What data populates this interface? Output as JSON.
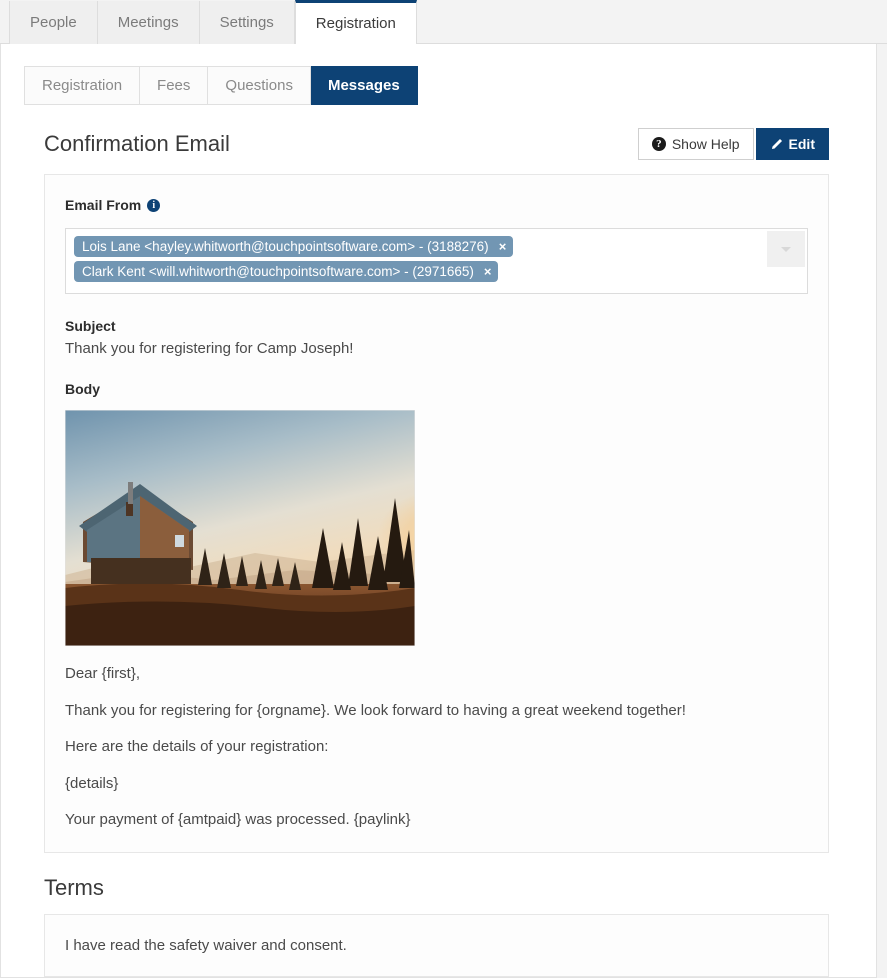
{
  "top_tabs": [
    {
      "label": "People",
      "active": false
    },
    {
      "label": "Meetings",
      "active": false
    },
    {
      "label": "Settings",
      "active": false
    },
    {
      "label": "Registration",
      "active": true
    }
  ],
  "sub_tabs": [
    {
      "label": "Registration",
      "active": false
    },
    {
      "label": "Fees",
      "active": false
    },
    {
      "label": "Questions",
      "active": false
    },
    {
      "label": "Messages",
      "active": true
    }
  ],
  "confirmation": {
    "title": "Confirmation Email",
    "show_help_label": "Show Help",
    "show_help_icon": "question-circle-icon",
    "edit_label": "Edit",
    "edit_icon": "pencil-icon",
    "email_from_label": "Email From",
    "email_from_info_icon": "info-circle-icon",
    "tokens": [
      {
        "text": "Lois Lane <hayley.whitworth@touchpointsoftware.com> - (3188276)",
        "remove": "×"
      },
      {
        "text": "Clark Kent <will.whitworth@touchpointsoftware.com> - (2971665)",
        "remove": "×"
      }
    ],
    "dropdown_icon": "chevron-down-icon",
    "subject_label": "Subject",
    "subject_value": "Thank you for registering for Camp Joseph!",
    "body_label": "Body",
    "body_image_alt": "cabin-at-sunset-photo",
    "body_paragraphs": [
      "Dear {first},",
      "Thank you for registering for {orgname}. We look forward to having a great weekend together!",
      "Here are the details of your registration:",
      "{details}",
      "Your payment of {amtpaid} was processed. {paylink}"
    ]
  },
  "terms": {
    "title": "Terms",
    "text": "I have read the safety waiver and consent."
  },
  "colors": {
    "brand_navy": "#0d4275",
    "token_blue": "#7296b3",
    "page_bg": "#f3f3f3"
  }
}
